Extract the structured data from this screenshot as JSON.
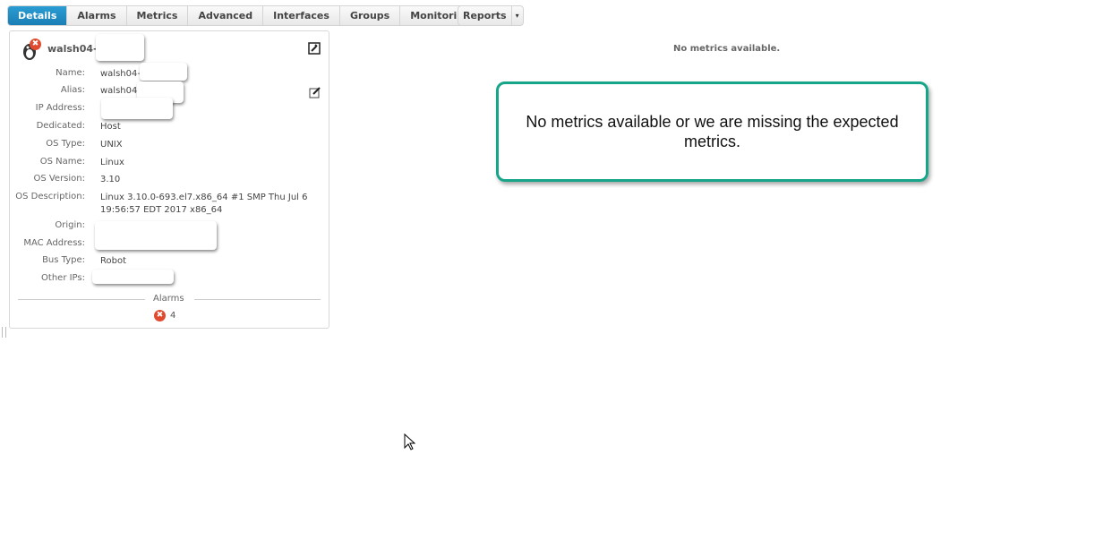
{
  "tabs": [
    "Details",
    "Alarms",
    "Metrics",
    "Advanced",
    "Interfaces",
    "Groups",
    "Monitoring"
  ],
  "reports": {
    "label": "Reports",
    "arrow": "▾"
  },
  "device": {
    "title": "walsh04-"
  },
  "fields": [
    {
      "label": "Name:",
      "value": "walsh04-"
    },
    {
      "label": "Alias:",
      "value": "walsh04"
    },
    {
      "label": "IP Address:",
      "value": ""
    },
    {
      "label": "Dedicated:",
      "value": "Host"
    },
    {
      "label": "OS Type:",
      "value": "UNIX"
    },
    {
      "label": "OS Name:",
      "value": "Linux"
    },
    {
      "label": "OS Version:",
      "value": "3.10"
    },
    {
      "label": "OS Description:",
      "value": "Linux 3.10.0-693.el7.x86_64 #1 SMP Thu Jul 6 19:56:57 EDT 2017 x86_64"
    },
    {
      "label": "Origin:",
      "value": ""
    },
    {
      "label": "MAC Address:",
      "value": ""
    },
    {
      "label": "Bus Type:",
      "value": "Robot"
    },
    {
      "label": "Other IPs:",
      "value": ""
    }
  ],
  "alarms": {
    "heading": "Alarms",
    "count": "4"
  },
  "metrics": {
    "empty": "No metrics available.",
    "callout": "No metrics available or we are missing the expected metrics."
  }
}
